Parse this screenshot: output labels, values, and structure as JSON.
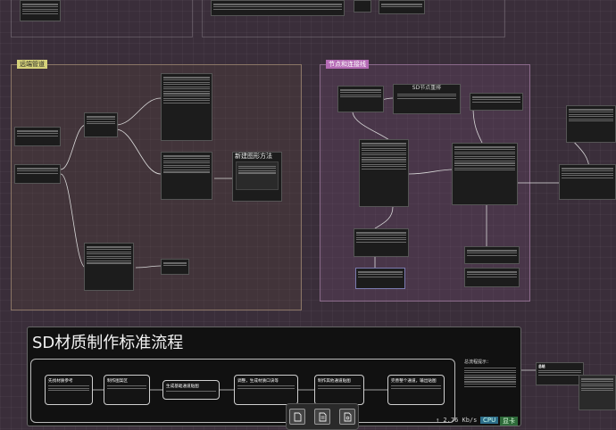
{
  "groups": {
    "left": {
      "title": "远端管道"
    },
    "middle": {
      "title": "节点和连接线"
    }
  },
  "big_image_node": {
    "title": "新建图形方法"
  },
  "sd_node": {
    "title": "SD节点重排"
  },
  "flow": {
    "title": "SD材质制作标准流程",
    "steps": [
      "先找材质参考",
      "制作图案区",
      "生成基础通道贴图",
      "调整，生成材质口诀等",
      "制作其他通道贴图",
      "完善整个通道，输出贴图"
    ]
  },
  "side_note": {
    "title": "总流程提示："
  },
  "right_node": {
    "title": "总结"
  },
  "status": {
    "net": "↑ 2.76 Kb/s",
    "cpu": "CPU",
    "gpu": "显卡"
  },
  "toolbar": {
    "icons": [
      "file-icon",
      "document-icon",
      "image-file-icon"
    ]
  }
}
